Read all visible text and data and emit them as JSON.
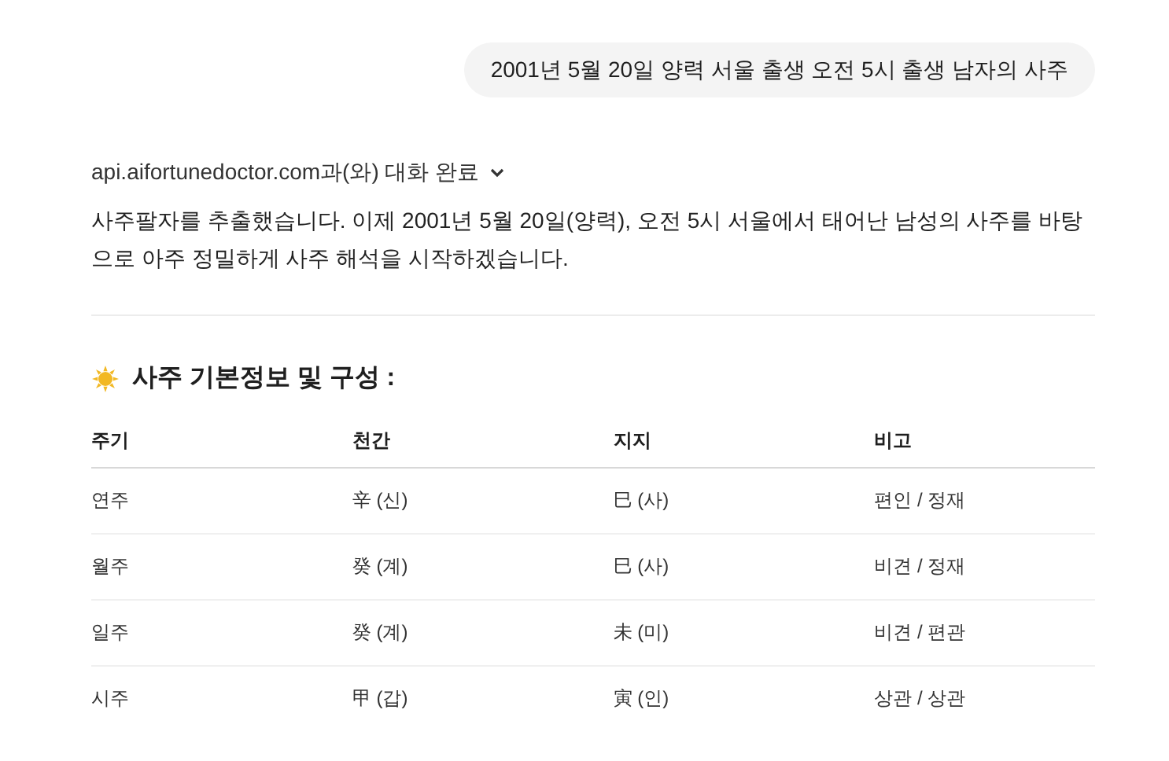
{
  "user_message": "2001년 5월 20일 양력 서울 출생 오전 5시 출생 남자의 사주",
  "tool_status": {
    "label": "api.aifortunedoctor.com과(와) 대화 완료",
    "expanded": false
  },
  "response": {
    "paragraph": "사주팔자를 추출했습니다. 이제 2001년 5월 20일(양력), 오전 5시 서울에서 태어난 남성의 사주를 바탕으로 아주 정밀하게 사주 해석을 시작하겠습니다.",
    "heading": "사주 기본정보 및 구성 :",
    "table": {
      "columns": [
        "주기",
        "천간",
        "지지",
        "비고"
      ],
      "rows": [
        [
          "연주",
          "辛 (신)",
          "巳 (사)",
          "편인 / 정재"
        ],
        [
          "월주",
          "癸 (계)",
          "巳 (사)",
          "비견 / 정재"
        ],
        [
          "일주",
          "癸 (계)",
          "未 (미)",
          "비견 / 편관"
        ],
        [
          "시주",
          "甲 (갑)",
          "寅 (인)",
          "상관 / 상관"
        ]
      ]
    }
  }
}
